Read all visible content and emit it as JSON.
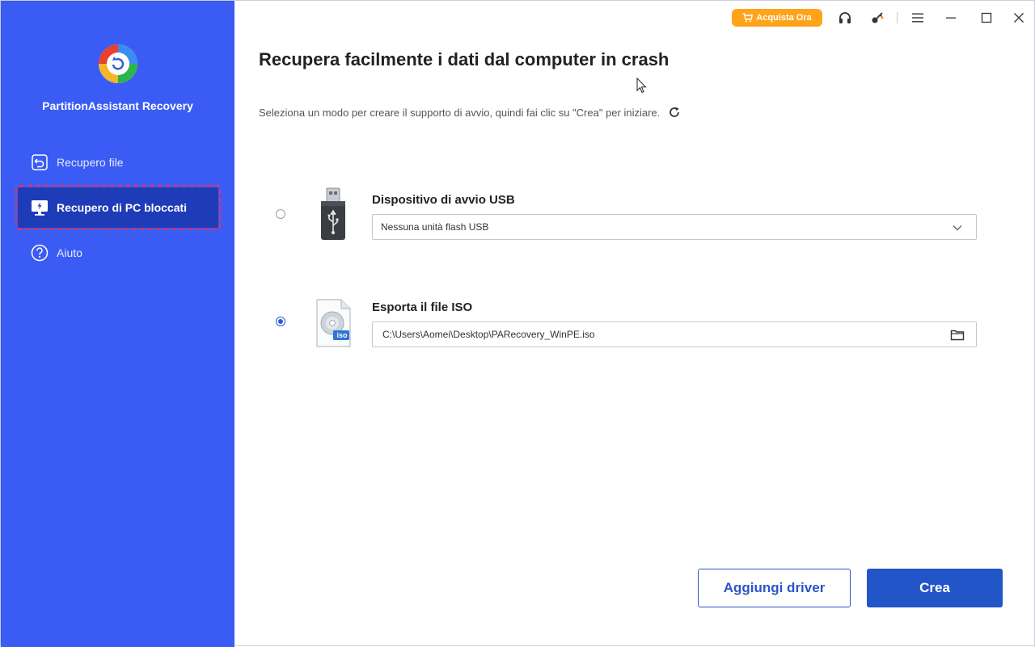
{
  "app": {
    "name": "PartitionAssistant Recovery"
  },
  "sidebar": {
    "items": [
      {
        "label": "Recupero file",
        "icon": "file-restore-icon"
      },
      {
        "label": "Recupero di PC bloccati",
        "icon": "crashed-pc-icon",
        "active": true
      },
      {
        "label": "Aiuto",
        "icon": "help-icon"
      }
    ]
  },
  "topbar": {
    "buy_label": "Acquista Ora",
    "icons": [
      "headset-icon",
      "key-icon",
      "menu-icon",
      "minimize-icon",
      "maximize-icon",
      "close-icon"
    ]
  },
  "main": {
    "title": "Recupera facilmente i dati dal computer in crash",
    "subtitle": "Seleziona un modo per creare il supporto di avvio, quindi fai clic su \"Crea\" per iniziare.",
    "options": [
      {
        "label": "Dispositivo di avvio USB",
        "value": "Nessuna unità flash USB",
        "selected": false,
        "icon": "usb-drive-icon",
        "control": "dropdown"
      },
      {
        "label": "Esporta il file ISO",
        "value": "C:\\Users\\Aomei\\Desktop\\PARecovery_WinPE.iso",
        "selected": true,
        "icon": "iso-file-icon",
        "badge": "iso",
        "control": "folder-browse"
      }
    ],
    "buttons": {
      "add_driver": "Aggiungi driver",
      "create": "Crea"
    }
  },
  "colors": {
    "sidebar_bg": "#3a5cf4",
    "active_item_bg": "#1f3cb8",
    "buy_button": "#ffa31a",
    "primary": "#2155c8"
  }
}
